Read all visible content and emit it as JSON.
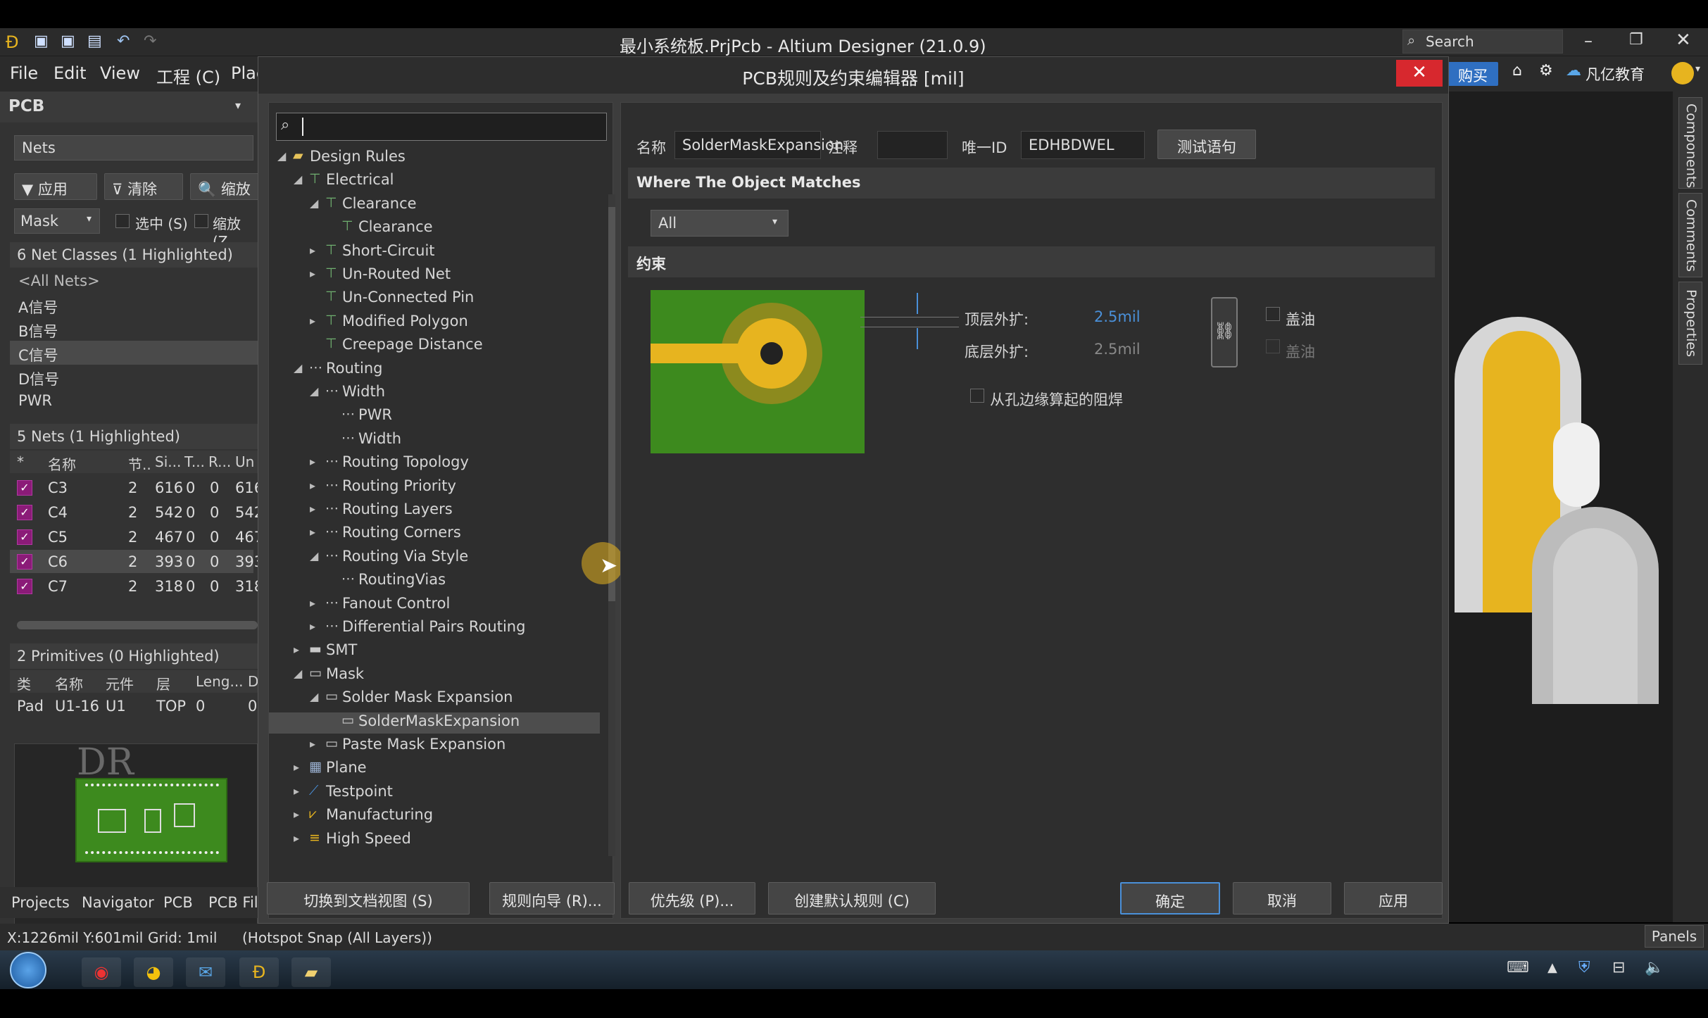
{
  "app": {
    "title": "最小系统板.PrjPcb - Altium Designer (21.0.9)",
    "search_placeholder": "Search",
    "buy_label": "购买",
    "brand": "凡亿教育"
  },
  "menu": [
    "File",
    "Edit",
    "View",
    "工程 (C)",
    "Plac"
  ],
  "left_panel": {
    "panel_title": "PCB",
    "filter_select": "Nets",
    "buttons": {
      "apply": "应用",
      "clear": "清除",
      "zoom": "缩放"
    },
    "mask_select": "Mask",
    "select_check": "选中 (S)",
    "zoom_check": "缩放 (Z",
    "net_classes_header": "6 Net Classes (1 Highlighted)",
    "net_classes": [
      "<All Nets>",
      "A信号",
      "B信号",
      "C信号",
      "D信号",
      "PWR"
    ],
    "nets_header": "5 Nets (1 Highlighted)",
    "nets_columns": [
      "*",
      "名称",
      "节..",
      "Si...",
      "T...",
      "R...",
      "Un"
    ],
    "nets": [
      {
        "name": "C3",
        "nodes": "2",
        "si": "616",
        "t": "0",
        "r": "0",
        "un": "616"
      },
      {
        "name": "C4",
        "nodes": "2",
        "si": "542",
        "t": "0",
        "r": "0",
        "un": "542"
      },
      {
        "name": "C5",
        "nodes": "2",
        "si": "467",
        "t": "0",
        "r": "0",
        "un": "467"
      },
      {
        "name": "C6",
        "nodes": "2",
        "si": "393",
        "t": "0",
        "r": "0",
        "un": "393"
      },
      {
        "name": "C7",
        "nodes": "2",
        "si": "318",
        "t": "0",
        "r": "0",
        "un": "318"
      }
    ],
    "primitives_header": "2 Primitives (0 Highlighted)",
    "primitives_columns": [
      "类",
      "名称",
      "元件",
      "层",
      "Leng...",
      "D"
    ],
    "primitives": [
      {
        "type": "Pad",
        "name": "U1-16",
        "comp": "U1",
        "layer": "TOP",
        "len": "0",
        "d": "0"
      }
    ],
    "preview_watermark": "DR",
    "tabs": [
      "Projects",
      "Navigator",
      "PCB",
      "PCB Fil"
    ]
  },
  "dialog": {
    "title": "PCB规则及约束编辑器 [mil]",
    "search_value": "",
    "tree": [
      {
        "label": "Design Rules",
        "level": 0,
        "arrow": "◢",
        "icon": "folder-icon"
      },
      {
        "label": "Electrical",
        "level": 1,
        "arrow": "◢",
        "icon": "rule-icon"
      },
      {
        "label": "Clearance",
        "level": 2,
        "arrow": "◢",
        "icon": "rule-icon"
      },
      {
        "label": "Clearance",
        "level": 3,
        "arrow": "",
        "icon": "rule-icon"
      },
      {
        "label": "Short-Circuit",
        "level": 2,
        "arrow": "▸",
        "icon": "rule-icon"
      },
      {
        "label": "Un-Routed Net",
        "level": 2,
        "arrow": "▸",
        "icon": "rule-icon"
      },
      {
        "label": "Un-Connected Pin",
        "level": 2,
        "arrow": "",
        "icon": "rule-icon"
      },
      {
        "label": "Modified Polygon",
        "level": 2,
        "arrow": "▸",
        "icon": "rule-icon"
      },
      {
        "label": "Creepage Distance",
        "level": 2,
        "arrow": "",
        "icon": "rule-icon"
      },
      {
        "label": "Routing",
        "level": 1,
        "arrow": "◢",
        "icon": "route-icon"
      },
      {
        "label": "Width",
        "level": 2,
        "arrow": "◢",
        "icon": "route-icon"
      },
      {
        "label": "PWR",
        "level": 3,
        "arrow": "",
        "icon": "route-icon"
      },
      {
        "label": "Width",
        "level": 3,
        "arrow": "",
        "icon": "route-icon"
      },
      {
        "label": "Routing Topology",
        "level": 2,
        "arrow": "▸",
        "icon": "route-icon"
      },
      {
        "label": "Routing Priority",
        "level": 2,
        "arrow": "▸",
        "icon": "route-icon"
      },
      {
        "label": "Routing Layers",
        "level": 2,
        "arrow": "▸",
        "icon": "route-icon"
      },
      {
        "label": "Routing Corners",
        "level": 2,
        "arrow": "▸",
        "icon": "route-icon"
      },
      {
        "label": "Routing Via Style",
        "level": 2,
        "arrow": "◢",
        "icon": "route-icon"
      },
      {
        "label": "RoutingVias",
        "level": 3,
        "arrow": "",
        "icon": "route-icon"
      },
      {
        "label": "Fanout Control",
        "level": 2,
        "arrow": "▸",
        "icon": "route-icon"
      },
      {
        "label": "Differential Pairs Routing",
        "level": 2,
        "arrow": "▸",
        "icon": "route-icon"
      },
      {
        "label": "SMT",
        "level": 1,
        "arrow": "▸",
        "icon": "smt-icon"
      },
      {
        "label": "Mask",
        "level": 1,
        "arrow": "◢",
        "icon": "mask-icon"
      },
      {
        "label": "Solder Mask Expansion",
        "level": 2,
        "arrow": "◢",
        "icon": "mask-icon"
      },
      {
        "label": "SolderMaskExpansion",
        "level": 3,
        "arrow": "",
        "icon": "mask-icon",
        "selected": true
      },
      {
        "label": "Paste Mask Expansion",
        "level": 2,
        "arrow": "▸",
        "icon": "mask-icon"
      },
      {
        "label": "Plane",
        "level": 1,
        "arrow": "▸",
        "icon": "plane-icon"
      },
      {
        "label": "Testpoint",
        "level": 1,
        "arrow": "▸",
        "icon": "testpoint-icon"
      },
      {
        "label": "Manufacturing",
        "level": 1,
        "arrow": "▸",
        "icon": "manufacturing-icon"
      },
      {
        "label": "High Speed",
        "level": 1,
        "arrow": "▸",
        "icon": "highspeed-icon"
      }
    ],
    "form": {
      "name_label": "名称",
      "name_value": "SolderMaskExpansion",
      "comment_label": "注释",
      "comment_value": "",
      "uid_label": "唯一ID",
      "uid_value": "EDHBDWEL",
      "test_button": "测试语句",
      "where_header": "Where The Object Matches",
      "where_select": "All",
      "constraint_header": "约束",
      "top_label": "顶层外扩:",
      "top_value": "2.5mil",
      "bottom_label": "底层外扩:",
      "bottom_value": "2.5mil",
      "tent_top": "盖油",
      "tent_bottom": "盖油",
      "from_hole_label": "从孔边缘算起的阻焊"
    },
    "footer": {
      "doc_view": "切换到文档视图 (S)",
      "wizard": "规则向导 (R)...",
      "priority": "优先级 (P)...",
      "default_rules": "创建默认规则 (C)",
      "ok": "确定",
      "cancel": "取消",
      "apply": "应用"
    }
  },
  "status": {
    "coords": "X:1226mil Y:601mil",
    "grid": "Grid: 1mil",
    "snap": "(Hotspot Snap (All Layers))",
    "panels": "Panels"
  },
  "right_dock": [
    "Components",
    "Comments",
    "Properties"
  ],
  "colors": {
    "accent_blue": "#4a90d9",
    "close_red": "#d7282e",
    "pcb_green": "#3d8a1e",
    "pad_gold": "#e7b41f",
    "highlight_purple": "#8b1b78"
  }
}
